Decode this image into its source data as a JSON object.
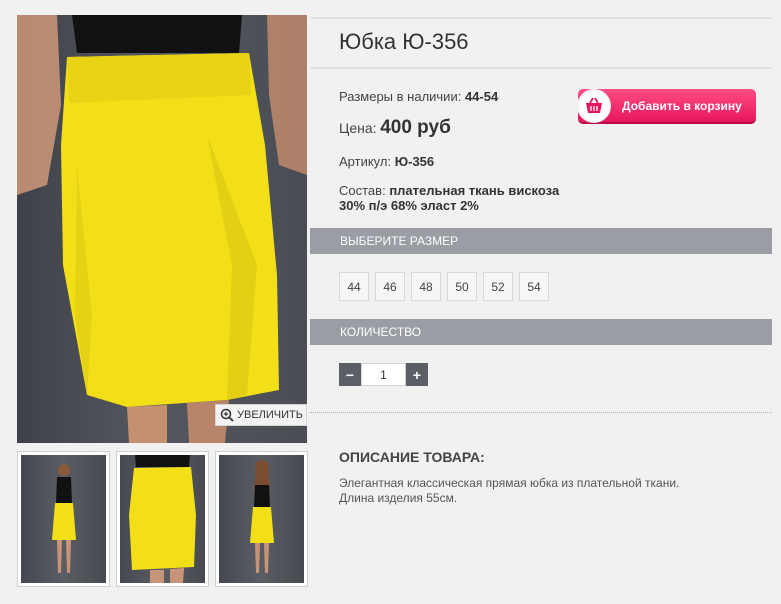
{
  "product": {
    "title": "Юбка Ю-356",
    "sizes_label": "Размеры в наличии:",
    "sizes_value": "44-54",
    "price_label": "Цена:",
    "price_value": "400 руб",
    "article_label": "Артикул:",
    "article_value": "Ю-356",
    "composition_label": "Состав:",
    "composition_line1": "плательная ткань вискоза",
    "composition_line2": "30% п/э 68% эласт 2%"
  },
  "cart_button": {
    "label": "Добавить в корзину",
    "color": "#e8165c"
  },
  "zoom_label": "УВЕЛИЧИТЬ",
  "size_section": {
    "title": "ВЫБЕРИТЕ РАЗМЕР",
    "options": [
      "44",
      "46",
      "48",
      "50",
      "52",
      "54"
    ]
  },
  "quantity_section": {
    "title": "КОЛИЧЕСТВО",
    "minus": "−",
    "plus": "+",
    "value": "1"
  },
  "description": {
    "title": "ОПИСАНИЕ ТОВАРА:",
    "line1": "Элегантная классическая прямая юбка из плательной ткани.",
    "line2": "Длина изделия 55см."
  },
  "colors": {
    "skirt": "#f2df18",
    "section_bar": "#9a9da3",
    "accent": "#e8165c"
  },
  "icons": {
    "zoom": "magnifier-plus-icon",
    "cart": "basket-icon"
  }
}
